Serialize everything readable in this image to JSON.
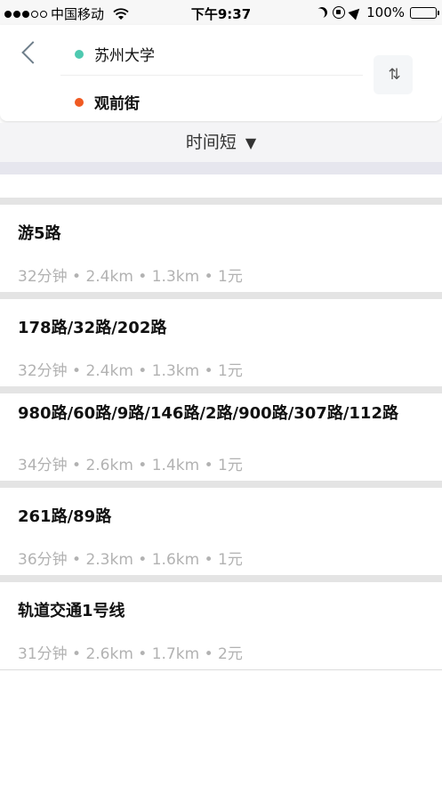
{
  "status_bar": {
    "carrier": "中国移动",
    "time": "下午9:37",
    "battery": "100%",
    "signal_bars_filled": 3,
    "signal_bars_total": 5,
    "battery_level": 1.0
  },
  "route_header": {
    "start": "苏州大学",
    "end": "观前街",
    "start_color": "#4ec9b0",
    "end_color": "#f05a22",
    "swap_icon": "⇅"
  },
  "sort": {
    "label": "时间短",
    "caret": "▼"
  },
  "routes": [
    {
      "title": "游5路",
      "meta": "32分钟 • 2.4km • 1.3km • 1元"
    },
    {
      "title": "178路/32路/202路",
      "meta": "32分钟 • 2.4km • 1.3km • 1元"
    },
    {
      "title": "980路/60路/9路/146路/2路/900路/307路/112路",
      "meta": "34分钟 • 2.6km • 1.4km • 1元"
    },
    {
      "title": "261路/89路",
      "meta": "36分钟 • 2.3km • 1.6km • 1元"
    },
    {
      "title": "轨道交通1号线",
      "meta": "31分钟 • 2.6km • 1.7km • 2元"
    }
  ]
}
